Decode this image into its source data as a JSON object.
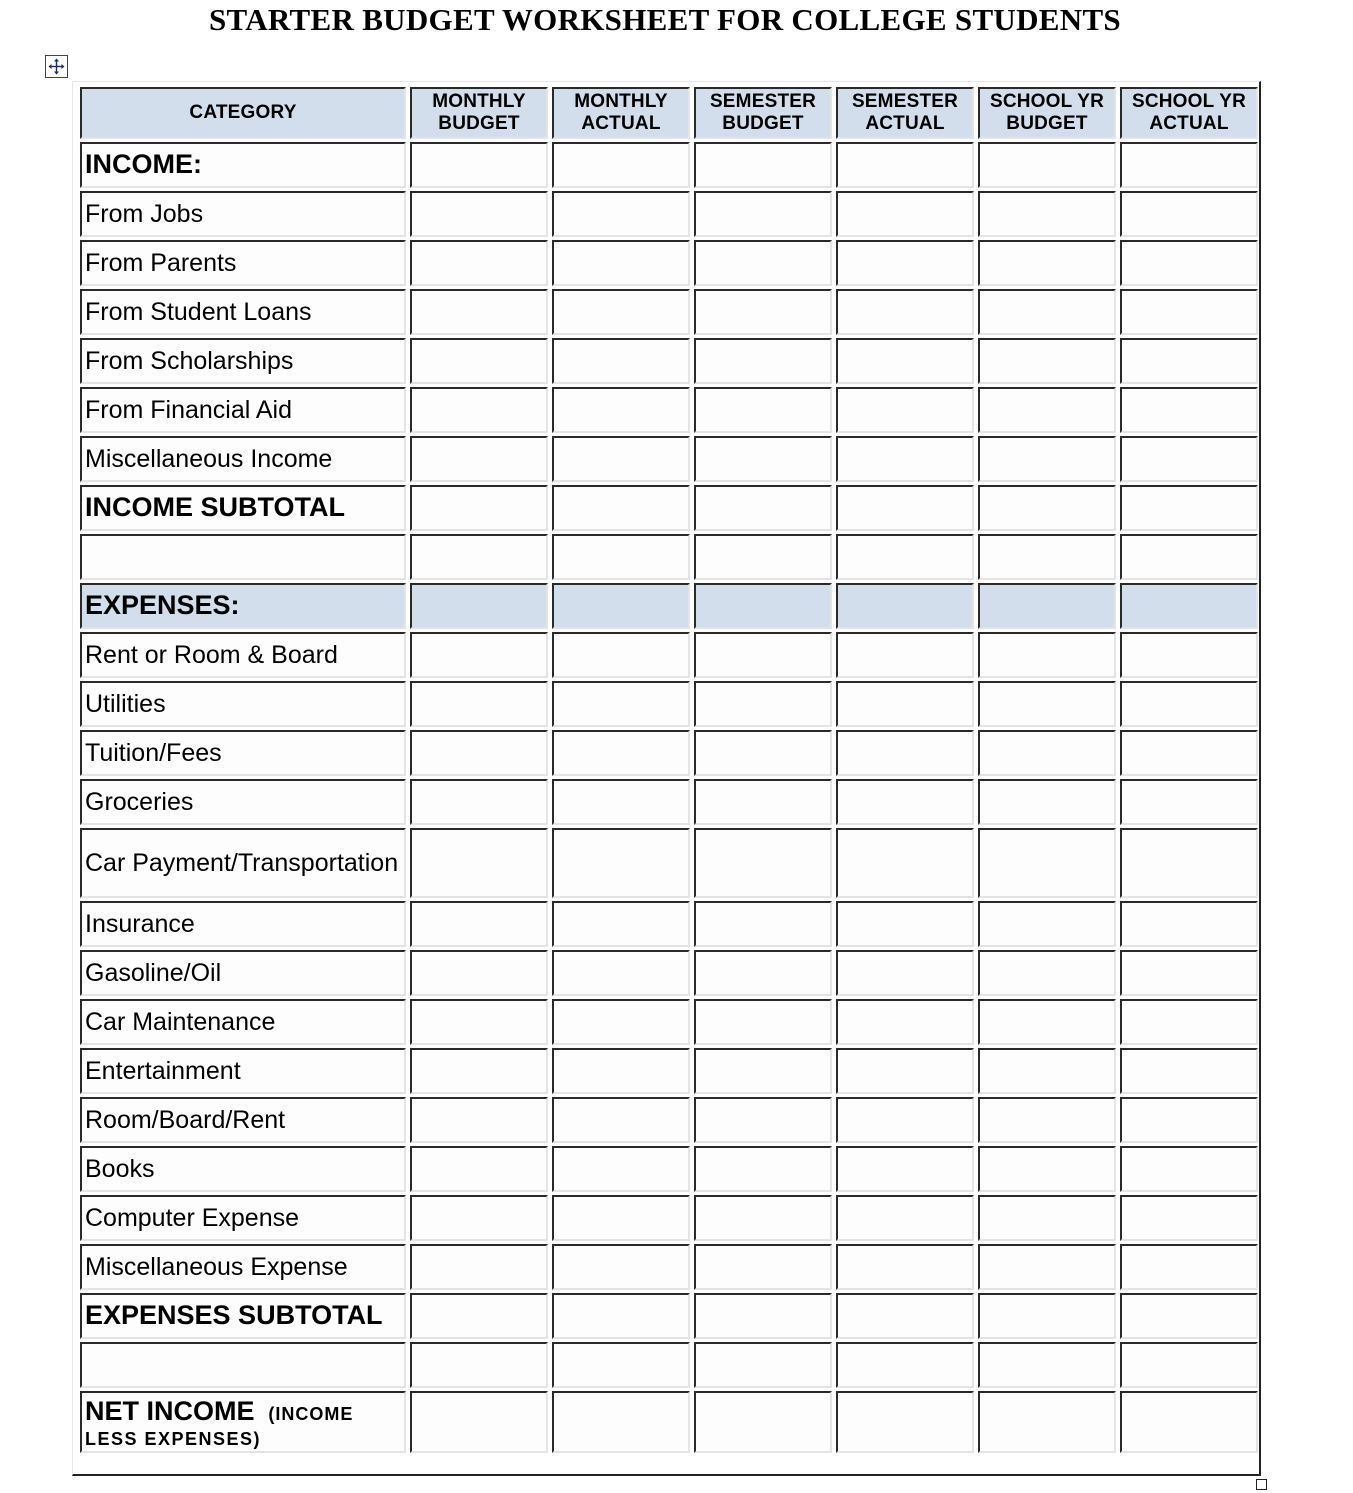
{
  "title": "STARTER BUDGET WORKSHEET FOR COLLEGE STUDENTS",
  "icons": {
    "move_handle": "move-arrows-icon",
    "resize_handle": "resize-square-icon"
  },
  "colors": {
    "header_fill": "#d3deec",
    "cell_fill": "#fdfdfd",
    "border_dark": "#2a2a2a"
  },
  "table": {
    "columns": [
      {
        "line1": "CATEGORY",
        "line2": ""
      },
      {
        "line1": "MONTHLY",
        "line2": "BUDGET"
      },
      {
        "line1": "MONTHLY",
        "line2": "ACTUAL"
      },
      {
        "line1": "SEMESTER",
        "line2": "BUDGET"
      },
      {
        "line1": "SEMESTER",
        "line2": "ACTUAL"
      },
      {
        "line1": "SCHOOL YR",
        "line2": "BUDGET"
      },
      {
        "line1": "SCHOOL YR",
        "line2": "ACTUAL"
      }
    ],
    "rows": [
      {
        "label": "INCOME:",
        "style": "section",
        "values": [
          "",
          "",
          "",
          "",
          "",
          ""
        ]
      },
      {
        "label": "From Jobs",
        "style": "item",
        "values": [
          "",
          "",
          "",
          "",
          "",
          ""
        ]
      },
      {
        "label": "From Parents",
        "style": "item",
        "values": [
          "",
          "",
          "",
          "",
          "",
          ""
        ]
      },
      {
        "label": "From Student Loans",
        "style": "item",
        "values": [
          "",
          "",
          "",
          "",
          "",
          ""
        ]
      },
      {
        "label": "From Scholarships",
        "style": "item",
        "values": [
          "",
          "",
          "",
          "",
          "",
          ""
        ]
      },
      {
        "label": "From Financial  Aid",
        "style": "item",
        "values": [
          "",
          "",
          "",
          "",
          "",
          ""
        ]
      },
      {
        "label": "Miscellaneous Income",
        "style": "item",
        "values": [
          "",
          "",
          "",
          "",
          "",
          ""
        ]
      },
      {
        "label": "INCOME  SUBTOTAL",
        "style": "subtotal",
        "values": [
          "",
          "",
          "",
          "",
          "",
          ""
        ]
      },
      {
        "label": "",
        "style": "blank",
        "values": [
          "",
          "",
          "",
          "",
          "",
          ""
        ]
      },
      {
        "label": "EXPENSES:",
        "style": "section-shaded",
        "values": [
          "",
          "",
          "",
          "",
          "",
          ""
        ]
      },
      {
        "label": "Rent  or Room & Board",
        "style": "item",
        "values": [
          "",
          "",
          "",
          "",
          "",
          ""
        ]
      },
      {
        "label": "Utilities",
        "style": "item",
        "values": [
          "",
          "",
          "",
          "",
          "",
          ""
        ]
      },
      {
        "label": "Tuition/Fees",
        "style": "item",
        "values": [
          "",
          "",
          "",
          "",
          "",
          ""
        ]
      },
      {
        "label": "Groceries",
        "style": "item",
        "values": [
          "",
          "",
          "",
          "",
          "",
          ""
        ]
      },
      {
        "label": "Car Payment/Transportation",
        "style": "item-tall",
        "values": [
          "",
          "",
          "",
          "",
          "",
          ""
        ]
      },
      {
        "label": "Insurance",
        "style": "item",
        "values": [
          "",
          "",
          "",
          "",
          "",
          ""
        ]
      },
      {
        "label": "Gasoline/Oil",
        "style": "item",
        "values": [
          "",
          "",
          "",
          "",
          "",
          ""
        ]
      },
      {
        "label": "Car  Maintenance",
        "style": "item",
        "values": [
          "",
          "",
          "",
          "",
          "",
          ""
        ]
      },
      {
        "label": "Entertainment",
        "style": "item",
        "values": [
          "",
          "",
          "",
          "",
          "",
          ""
        ]
      },
      {
        "label": "Room/Board/Rent",
        "style": "item",
        "values": [
          "",
          "",
          "",
          "",
          "",
          ""
        ]
      },
      {
        "label": "Books",
        "style": "item",
        "values": [
          "",
          "",
          "",
          "",
          "",
          ""
        ]
      },
      {
        "label": "Computer Expense",
        "style": "item",
        "values": [
          "",
          "",
          "",
          "",
          "",
          ""
        ]
      },
      {
        "label": "Miscellaneous Expense",
        "style": "item",
        "values": [
          "",
          "",
          "",
          "",
          "",
          ""
        ]
      },
      {
        "label": "EXPENSES SUBTOTAL",
        "style": "subtotal",
        "values": [
          "",
          "",
          "",
          "",
          "",
          ""
        ]
      },
      {
        "label": "",
        "style": "blank",
        "values": [
          "",
          "",
          "",
          "",
          "",
          ""
        ]
      },
      {
        "label": "NET INCOME",
        "sublabel_1": "(INCOME",
        "sublabel_2": "LESS EXPENSES)",
        "style": "net",
        "values": [
          "",
          "",
          "",
          "",
          "",
          ""
        ]
      }
    ]
  }
}
